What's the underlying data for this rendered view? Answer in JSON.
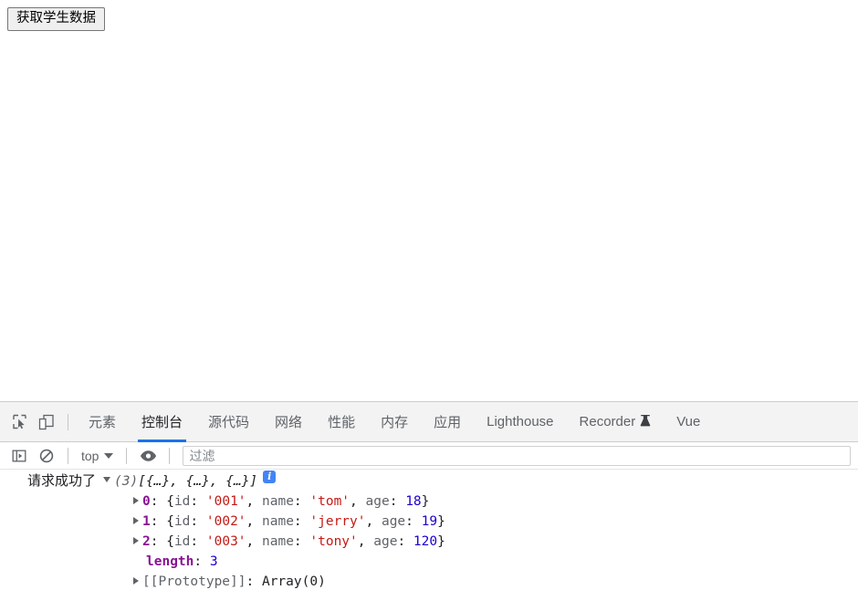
{
  "page": {
    "fetch_button_label": "获取学生数据"
  },
  "devtools": {
    "toolbar_icons": [
      {
        "name": "inspect-element-icon",
        "title": "检查"
      },
      {
        "name": "device-toolbar-icon",
        "title": "切换设备工具栏"
      }
    ],
    "tabs": [
      {
        "label": "元素",
        "active": false
      },
      {
        "label": "控制台",
        "active": true
      },
      {
        "label": "源代码",
        "active": false
      },
      {
        "label": "网络",
        "active": false
      },
      {
        "label": "性能",
        "active": false
      },
      {
        "label": "内存",
        "active": false
      },
      {
        "label": "应用",
        "active": false
      },
      {
        "label": "Lighthouse",
        "active": false
      },
      {
        "label": "Recorder",
        "active": false,
        "badge": "experiment-flask-icon"
      },
      {
        "label": "Vue",
        "active": false
      }
    ],
    "console_toolbar": {
      "sidebar_toggle_icon": "console-sidebar-icon",
      "clear_icon": "clear-console-icon",
      "context_value": "top",
      "eye_icon": "live-expression-eye-icon",
      "filter_placeholder": "过滤",
      "filter_value": ""
    },
    "console": {
      "message_label": "请求成功了",
      "array_count": "(3)",
      "array_preview": "[{…}, {…}, {…}]",
      "info_badge": "i",
      "expanded": true,
      "items": [
        {
          "index": "0",
          "open_brace": "{",
          "id_key": "id",
          "id_value": "'001'",
          "name_key": "name",
          "name_value": "'tom'",
          "age_key": "age",
          "age_value": "18",
          "close_brace": "}"
        },
        {
          "index": "1",
          "open_brace": "{",
          "id_key": "id",
          "id_value": "'002'",
          "name_key": "name",
          "name_value": "'jerry'",
          "age_key": "age",
          "age_value": "19",
          "close_brace": "}"
        },
        {
          "index": "2",
          "open_brace": "{",
          "id_key": "id",
          "id_value": "'003'",
          "name_key": "name",
          "name_value": "'tony'",
          "age_key": "age",
          "age_value": "120",
          "close_brace": "}"
        }
      ],
      "length_key": "length",
      "length_value": "3",
      "prototype_key": "[[Prototype]]",
      "prototype_value": "Array(0)"
    }
  },
  "colors": {
    "accent": "#1a73e8",
    "info_badge": "#4285f4",
    "string": "#c41a16",
    "number": "#1c00cf",
    "index": "#881391",
    "key": "#5f6368",
    "tabbar_bg": "#f3f3f3"
  }
}
